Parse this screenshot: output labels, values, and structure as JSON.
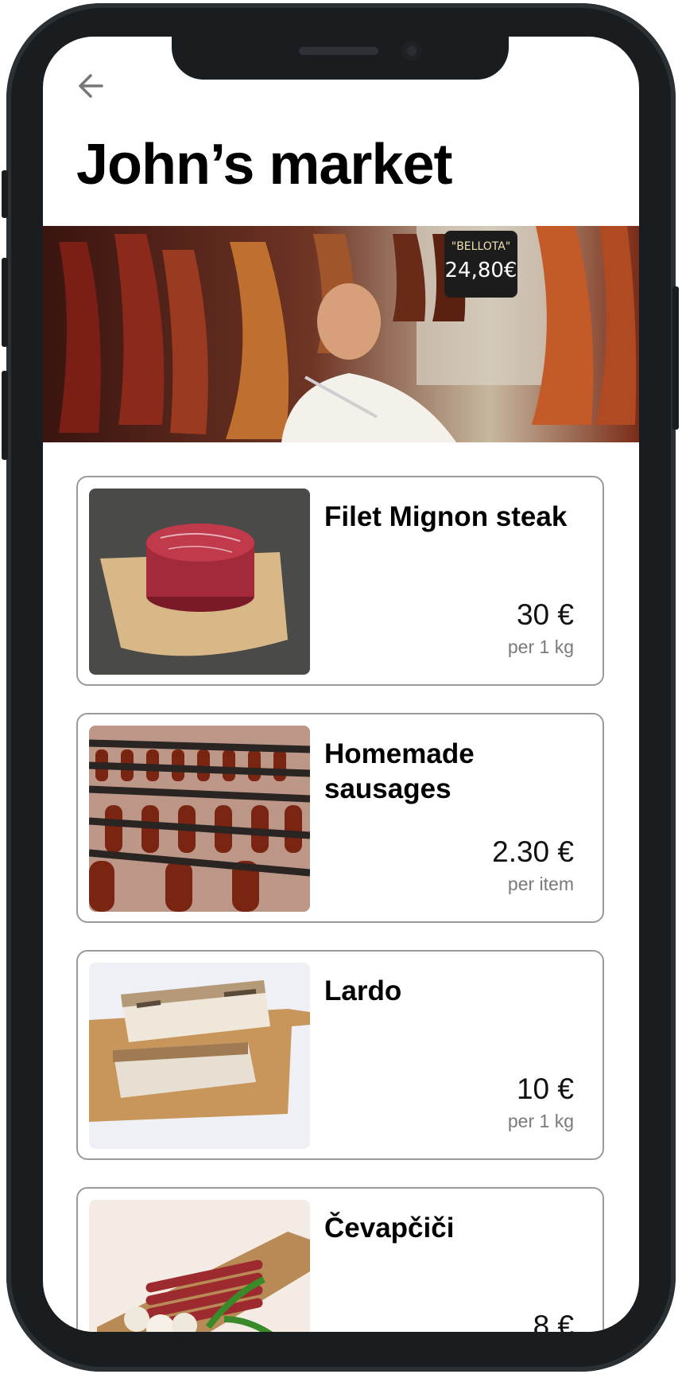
{
  "header": {
    "title": "John’s market"
  },
  "icons": {
    "back": "arrow-left-icon"
  },
  "colors": {
    "frame": "#1a1d20",
    "card_border": "#9a9a9a",
    "unit_text": "#7a7a7a"
  },
  "products": [
    {
      "name": "Filet Mignon steak",
      "price": "30 €",
      "unit": "per 1 kg"
    },
    {
      "name": "Homemade sausages",
      "price": "2.30 €",
      "unit": "per item"
    },
    {
      "name": "Lardo",
      "price": "10 €",
      "unit": "per 1 kg"
    },
    {
      "name": "Čevapčiči",
      "price": "8 €",
      "unit": ""
    }
  ]
}
